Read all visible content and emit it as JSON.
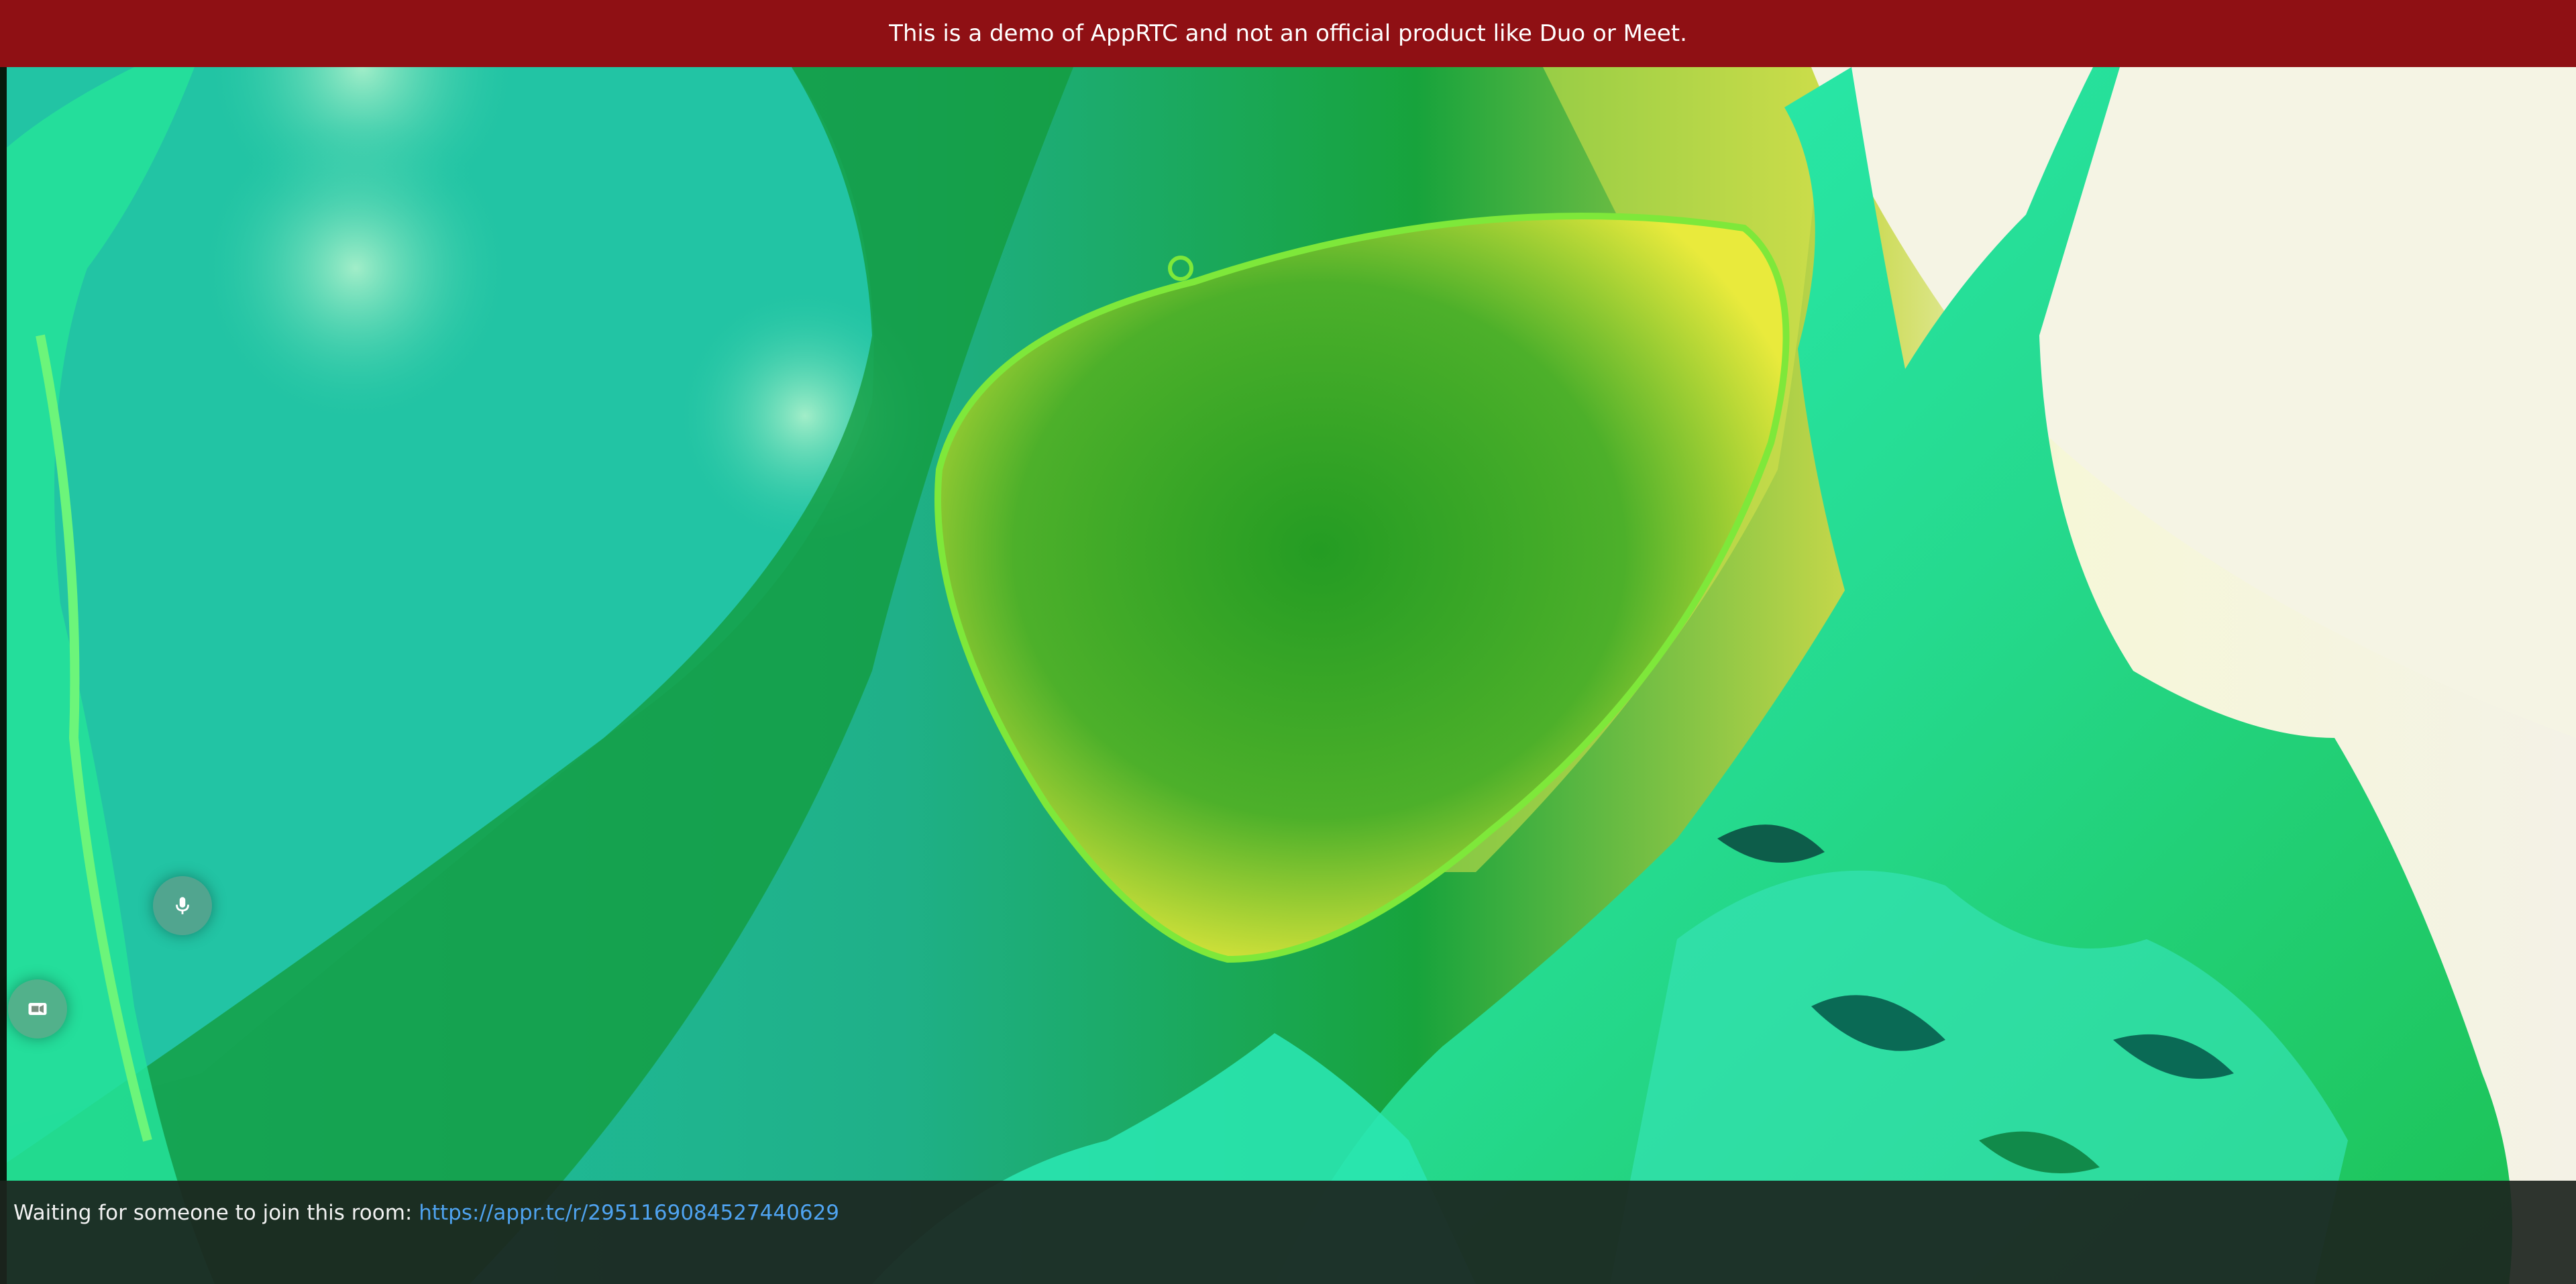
{
  "banner": {
    "text": "This is a demo of AppRTC and not an official product like Duo or Meet."
  },
  "controls": {
    "mic_icon": "microphone-icon",
    "camera_icon": "video-camera-icon"
  },
  "status": {
    "waiting_text": "Waiting for someone to join this room: ",
    "room_url": "https://appr.tc/r/2951169084527440629"
  },
  "colors": {
    "banner_bg": "#8f1014",
    "link": "#4fa3f0",
    "status_bg": "#1c241e"
  }
}
